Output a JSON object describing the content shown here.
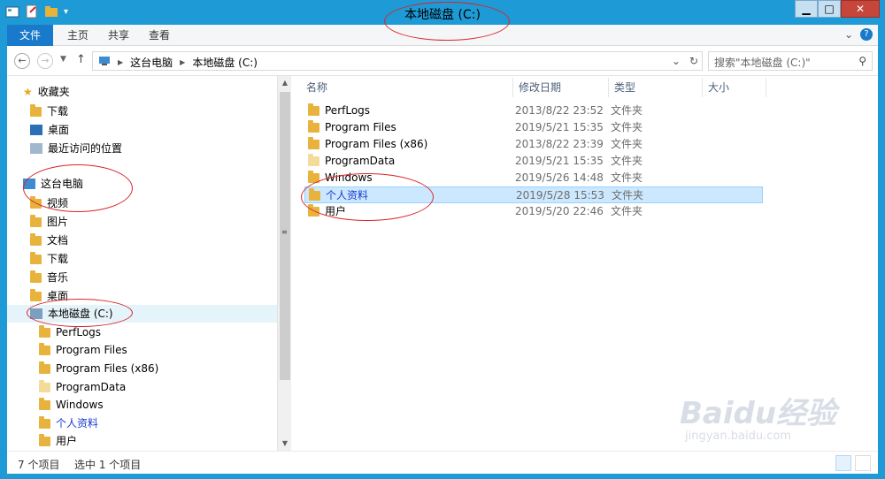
{
  "window": {
    "title": "本地磁盘 (C:)"
  },
  "ribbon": {
    "tabs": [
      "文件",
      "主页",
      "共享",
      "查看"
    ]
  },
  "address": {
    "crumbs": [
      "这台电脑",
      "本地磁盘 (C:)"
    ]
  },
  "search": {
    "placeholder": "搜索\"本地磁盘 (C:)\""
  },
  "nav": {
    "favorites_label": "收藏夹",
    "favorites": [
      "下载",
      "桌面",
      "最近访问的位置"
    ],
    "pc_label": "这台电脑",
    "pc_items": [
      "视频",
      "图片",
      "文档",
      "下载",
      "音乐",
      "桌面"
    ],
    "drive_label": "本地磁盘 (C:)",
    "drive_children": [
      "PerfLogs",
      "Program Files",
      "Program Files (x86)",
      "ProgramData",
      "Windows",
      "个人资料",
      "用户"
    ]
  },
  "columns": [
    "名称",
    "修改日期",
    "类型",
    "大小"
  ],
  "files": [
    {
      "name": "PerfLogs",
      "date": "2013/8/22 23:52",
      "type": "文件夹"
    },
    {
      "name": "Program Files",
      "date": "2019/5/21 15:35",
      "type": "文件夹"
    },
    {
      "name": "Program Files (x86)",
      "date": "2013/8/22 23:39",
      "type": "文件夹"
    },
    {
      "name": "ProgramData",
      "date": "2019/5/21 15:35",
      "type": "文件夹"
    },
    {
      "name": "Windows",
      "date": "2019/5/26 14:48",
      "type": "文件夹"
    },
    {
      "name": "个人资料",
      "date": "2019/5/28 15:53",
      "type": "文件夹"
    },
    {
      "name": "用户",
      "date": "2019/5/20 22:46",
      "type": "文件夹"
    }
  ],
  "status": {
    "count": "7 个项目",
    "selected": "选中 1 个项目"
  },
  "watermark": {
    "brand": "Baidu经验",
    "url": "jingyan.baidu.com"
  },
  "colors": {
    "frame": "#1e9ad6",
    "file_tab": "#1979ca",
    "annotation": "#d9252a",
    "selection": "#cce8ff"
  }
}
